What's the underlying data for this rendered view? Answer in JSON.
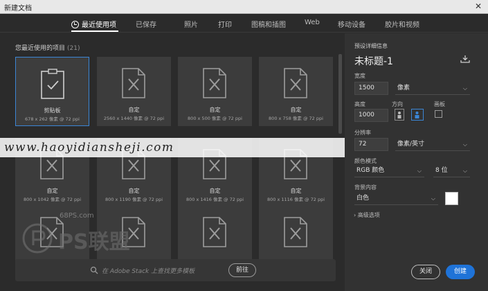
{
  "window": {
    "title": "新建文档",
    "close": "✕"
  },
  "tabs": [
    {
      "label": "最近使用项",
      "active": true
    },
    {
      "label": "已保存"
    },
    {
      "label": "照片"
    },
    {
      "label": "打印"
    },
    {
      "label": "图稿和插图"
    },
    {
      "label": "Web"
    },
    {
      "label": "移动设备"
    },
    {
      "label": "胶片和视频"
    }
  ],
  "recent": {
    "title": "您最近使用的项目",
    "count": "(21)",
    "items": [
      {
        "name": "剪贴板",
        "dims": "678 x 262 像素 @ 72 ppi",
        "icon": "clipboard-icon",
        "selected": true
      },
      {
        "name": "自定",
        "dims": "2560 x 1440 像素 @ 72 ppi",
        "icon": "document-icon"
      },
      {
        "name": "自定",
        "dims": "800 x 500 像素 @ 72 ppi",
        "icon": "document-icon"
      },
      {
        "name": "自定",
        "dims": "800 x 758 像素 @ 72 ppi",
        "icon": "document-icon"
      },
      {
        "name": "自定",
        "dims": "800 x 1042 像素 @ 72 ppi",
        "icon": "document-icon"
      },
      {
        "name": "自定",
        "dims": "800 x 1190 像素 @ 72 ppi",
        "icon": "document-icon"
      },
      {
        "name": "自定",
        "dims": "800 x 1416 像素 @ 72 ppi",
        "icon": "document-icon"
      },
      {
        "name": "自定",
        "dims": "800 x 1116 像素 @ 72 ppi",
        "icon": "document-icon"
      },
      {
        "name": "",
        "dims": "",
        "icon": "document-icon"
      },
      {
        "name": "",
        "dims": "",
        "icon": "document-icon"
      },
      {
        "name": "",
        "dims": "",
        "icon": "document-icon"
      },
      {
        "name": "",
        "dims": "",
        "icon": "document-icon"
      }
    ]
  },
  "watermark": {
    "text": "www.haoyidiansheji.com",
    "site": "68PS.com",
    "brand": "PS联盟"
  },
  "stock": {
    "placeholder": "在 Adobe Stack 上查找更多模板",
    "go": "前往"
  },
  "preset": {
    "section": "预设详细信息",
    "doc_name": "未标题-1",
    "width_label": "宽度",
    "width": "1500",
    "width_unit": "像素",
    "height_label": "高度",
    "height": "1000",
    "orientation_label": "方向",
    "artboard_label": "画板",
    "resolution_label": "分辨率",
    "resolution": "72",
    "resolution_unit": "像素/英寸",
    "color_mode_label": "颜色模式",
    "color_mode": "RGB 颜色",
    "bit_depth": "8 位",
    "background_label": "背景内容",
    "background": "白色",
    "advanced": "高级选项"
  },
  "buttons": {
    "close": "关闭",
    "create": "创建"
  },
  "colors": {
    "accent": "#3b86d6",
    "create_bg": "#1f73d8",
    "panel": "#323232",
    "bg": "#2b2b2b"
  }
}
